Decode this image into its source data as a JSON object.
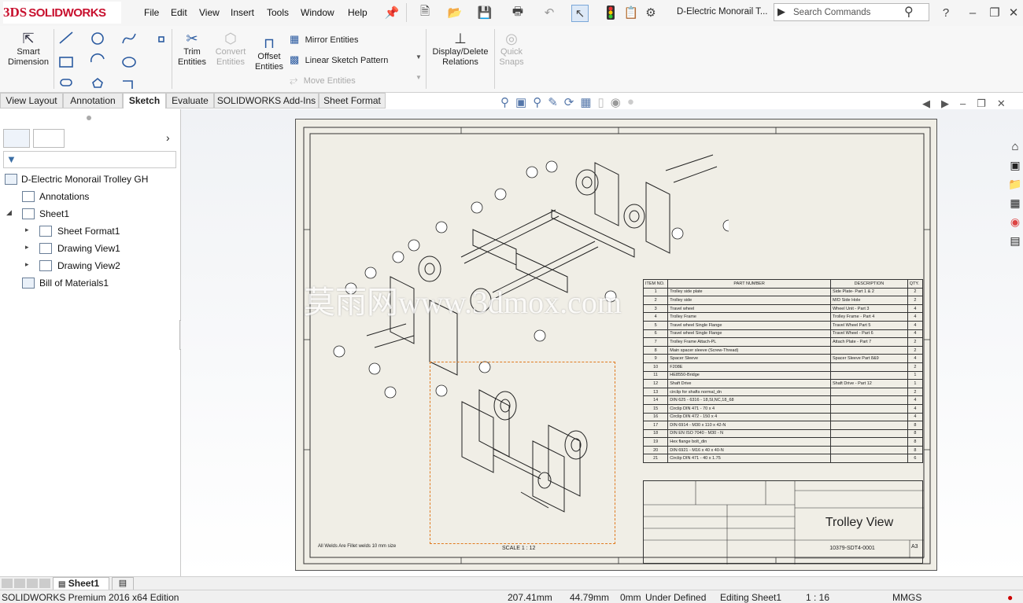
{
  "app": {
    "brand_prefix": "3DS",
    "brand_name": "SOLIDWORKS",
    "document_title": "D-Electric Monorail T..."
  },
  "menu": [
    "File",
    "Edit",
    "View",
    "Insert",
    "Tools",
    "Window",
    "Help"
  ],
  "search": {
    "placeholder": "Search Commands"
  },
  "ribbon": {
    "smart_dimension": "Smart Dimension",
    "trim_entities": "Trim Entities",
    "convert_entities": "Convert Entities",
    "offset_entities": "Offset Entities",
    "mirror_entities": "Mirror Entities",
    "linear_sketch_pattern": "Linear Sketch Pattern",
    "move_entities": "Move Entities",
    "display_delete_relations": "Display/Delete Relations",
    "quick_snaps": "Quick Snaps"
  },
  "tabs": [
    "View Layout",
    "Annotation",
    "Sketch",
    "Evaluate",
    "SOLIDWORKS Add-Ins",
    "Sheet Format"
  ],
  "active_tab": "Sketch",
  "tree": {
    "root": "D-Electric Monorail Trolley GH",
    "items": [
      "Annotations",
      "Sheet1",
      "Sheet Format1",
      "Drawing View1",
      "Drawing View2",
      "Bill of Materials1"
    ]
  },
  "drawing": {
    "title": "Trolley View",
    "drawing_number": "10379-SDT4-0001",
    "sheet_size": "A3",
    "scale_label": "SCALE 1 : 12",
    "note": "All Welds Are Fillet welds 10 mm  size",
    "watermark": "莫雨网www.3dmox.com",
    "bom_headers": [
      "ITEM NO.",
      "PART NUMBER",
      "DESCRIPTION",
      "QTY."
    ],
    "bom_rows": [
      [
        "1",
        "Trolley side plate",
        "Side Plate- Part 1 & 2",
        "2"
      ],
      [
        "2",
        "Trolley side",
        "M/D Side Hole",
        "2"
      ],
      [
        "3",
        "Travel wheel",
        "Wheel Unit - Part 3",
        "4"
      ],
      [
        "4",
        "Trolley Frame",
        "Trolley Frame - Part 4",
        "4"
      ],
      [
        "5",
        "Travel wheel Single Flange",
        "Travel Wheel Part 5",
        "4"
      ],
      [
        "6",
        "Travel wheel Single Flange",
        "Travel Wheel - Part 6",
        "4"
      ],
      [
        "7",
        "Trolley Frame Attach-PL",
        "Attach Plate - Part 7",
        "2"
      ],
      [
        "8",
        "Main spacer sleeve (Screw-Thread)",
        "",
        "2"
      ],
      [
        "9",
        "Spacer Sleeve",
        "Spacer Sleeve Part 8&9",
        "4"
      ],
      [
        "10",
        "F208E",
        "",
        "2"
      ],
      [
        "11",
        "HE8550-Bridge",
        "",
        "1"
      ],
      [
        "12",
        "Shaft Drive",
        "Shaft Drive - Part 12",
        "1"
      ],
      [
        "13",
        "circlip for shafts normal_dn",
        "",
        "2"
      ],
      [
        "14",
        "DIN 625 - 6316 - 18,SI,NC,18_68",
        "",
        "4"
      ],
      [
        "15",
        "Circlip DIN 471 - 70 x 4",
        "",
        "4"
      ],
      [
        "16",
        "Circlip DIN 472 - 150 x 4",
        "",
        "4"
      ],
      [
        "17",
        "DIN 6914 - M30 x 110 x 42-N",
        "",
        "8"
      ],
      [
        "18",
        "DIN EN ISO 7040 - M30 - N",
        "",
        "8"
      ],
      [
        "19",
        "Hex flange bolt_din",
        "",
        "8"
      ],
      [
        "20",
        "DIN 6921 - M16 x 40 x 40-N",
        "",
        "8"
      ],
      [
        "21",
        "Circlip DIN 471 - 40 x 1.75",
        "",
        "6"
      ]
    ]
  },
  "sheet_tab": "Sheet1",
  "status": {
    "edition": "SOLIDWORKS Premium 2016 x64 Edition",
    "x": "207.41mm",
    "y": "44.79mm",
    "z": "0mm",
    "definition": "Under Defined",
    "editing": "Editing Sheet1",
    "scale": "1 : 16",
    "units": "MMGS"
  }
}
